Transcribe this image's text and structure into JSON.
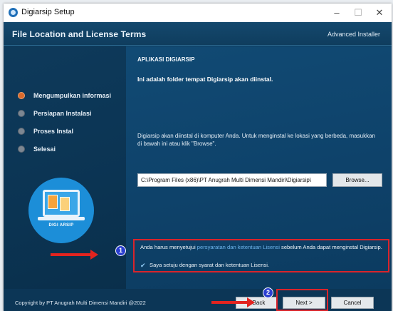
{
  "window": {
    "title": "Digiarsip Setup",
    "controls": {
      "minimize": "–",
      "maximize": "☐",
      "close": "✕"
    }
  },
  "header": {
    "title": "File Location and License Terms",
    "brand": "Advanced Installer"
  },
  "sidebar": {
    "steps": [
      {
        "label": "Mengumpulkan informasi",
        "active": true
      },
      {
        "label": "Persiapan Instalasi",
        "active": false
      },
      {
        "label": "Proses Instal",
        "active": false
      },
      {
        "label": "Selesai",
        "active": false
      }
    ],
    "logo_text": "DIGI ARSIP"
  },
  "main": {
    "heading": "APLIKASI DIGIARSIP",
    "subheading": "Ini adalah folder tempat Digiarsip akan diinstal.",
    "description": "Digiarsip akan diinstal di komputer Anda. Untuk menginstal ke lokasi yang berbeda, masukkan di bawah ini atau klik \"Browse\".",
    "install_path": "C:\\Program Files (x86)\\PT Anugrah Multi Dimensi Mandiri\\Digiarsip\\",
    "browse_label": "Browse...",
    "license": {
      "text_before": "Anda harus menyetujui ",
      "link_text": "persyaratan dan ketentuan Lisensi",
      "text_after": " sebelum Anda dapat menginstal Digiarsip.",
      "agree_label": "Saya setuju dengan syarat dan ketentuan Lisensi.",
      "agree_checked": true
    }
  },
  "footer": {
    "copyright": "Copyright by PT Anugrah Multi Dimensi Mandiri @2022",
    "back_label": "< Back",
    "next_label": "Next >",
    "cancel_label": "Cancel"
  },
  "annotations": {
    "marker_1": "1",
    "marker_2": "2",
    "highlight_color": "#d9242b",
    "marker_color": "#2b3fd1"
  },
  "colors": {
    "accent_active_step": "#d96a2c",
    "header_bg": "#14486d",
    "link": "#6fb5ec"
  }
}
